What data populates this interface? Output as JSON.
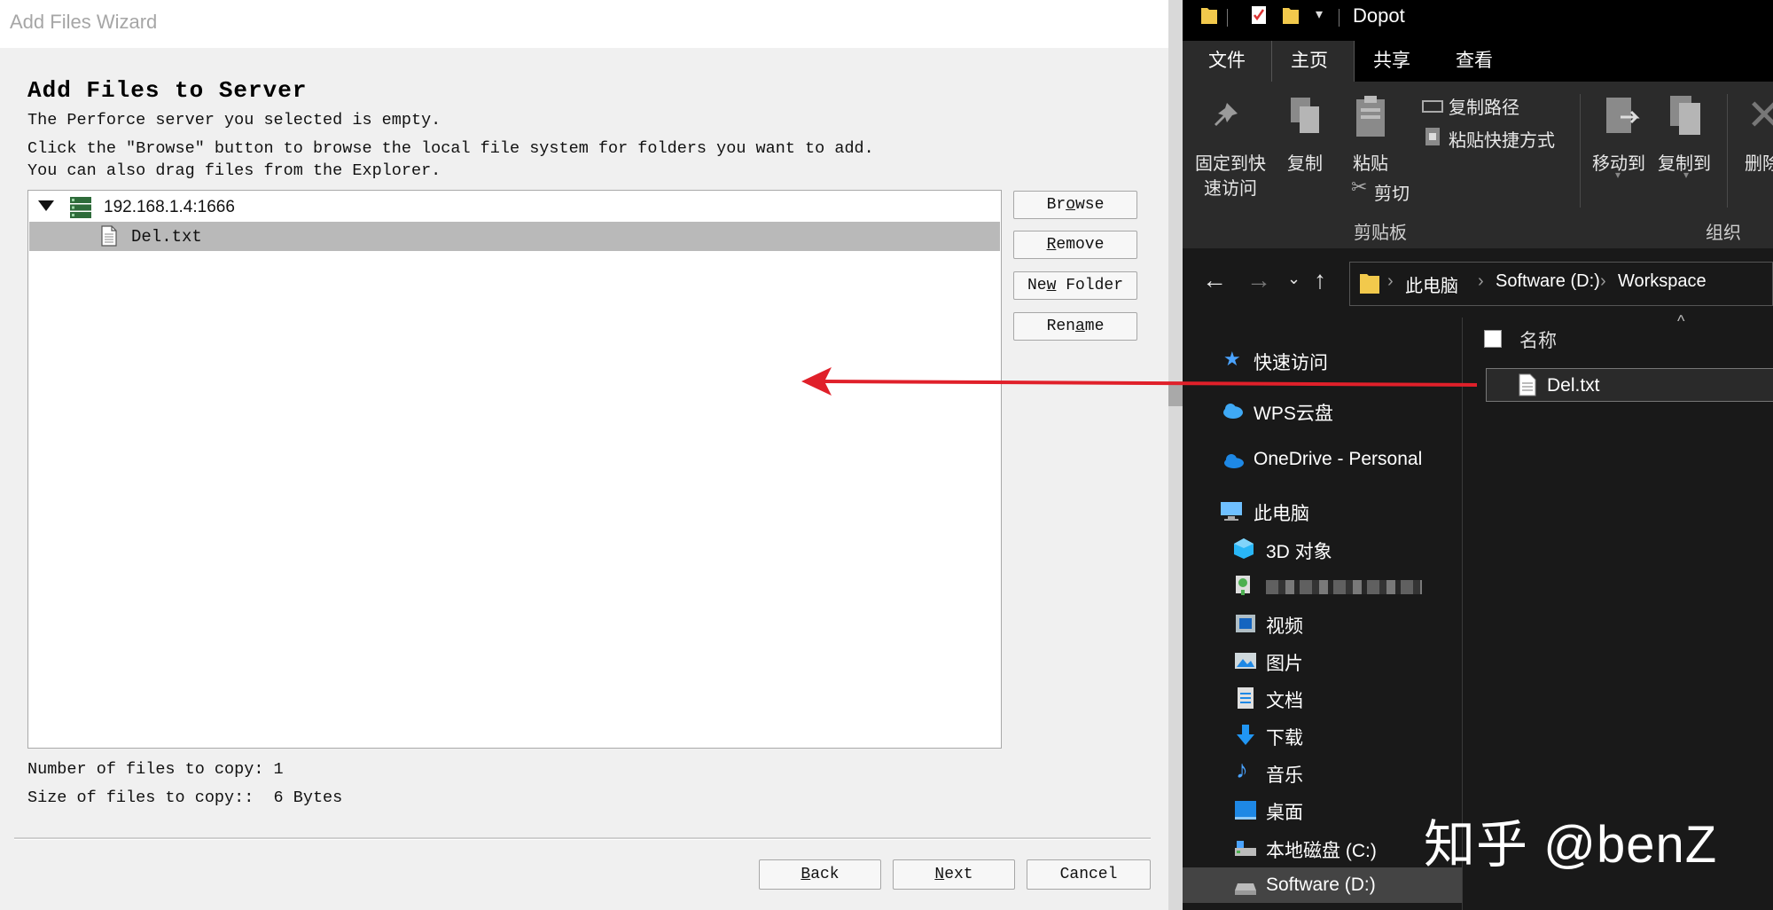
{
  "wizard": {
    "window_title": "Add Files Wizard",
    "heading": "Add Files to Server",
    "lines": [
      "The Perforce server you selected is empty.",
      "Click the \"Browse\" button to browse the local file system for folders you want to add.",
      "You can also drag files from the Explorer."
    ],
    "tree": {
      "server": "192.168.1.4:1666",
      "file": "Del.txt"
    },
    "side_buttons": [
      {
        "pre": "Br",
        "u": "o",
        "post": "wse"
      },
      {
        "pre": "",
        "u": "R",
        "post": "emove"
      },
      {
        "pre": "Ne",
        "u": "w",
        "post": " Folder"
      },
      {
        "pre": "Ren",
        "u": "a",
        "post": "me"
      }
    ],
    "stats": {
      "count_line": "Number of files to copy: 1",
      "size_line": "Size of files to copy::  6 Bytes"
    },
    "footer_buttons": [
      {
        "pre": "",
        "u": "B",
        "post": "ack"
      },
      {
        "pre": "",
        "u": "N",
        "post": "ext"
      },
      {
        "pre": "",
        "u": "",
        "post": "Cancel"
      }
    ]
  },
  "explorer": {
    "title": "Dopot",
    "tabs": [
      "文件",
      "主页",
      "共享",
      "查看"
    ],
    "ribbon": {
      "pin_label_1": "固定到快",
      "pin_label_2": "速访问",
      "copy_label": "复制",
      "paste_label": "粘贴",
      "copy_path_label": "复制路径",
      "paste_shortcut_label": "粘贴快捷方式",
      "cut_label": "剪切",
      "clipboard_group": "剪贴板",
      "move_to_label": "移动到",
      "copy_to_label": "复制到",
      "delete_label": "删除",
      "organize_group": "组织"
    },
    "breadcrumb": [
      "此电脑",
      "Software (D:)",
      "Workspace"
    ],
    "nav": {
      "quick_access": "快速访问",
      "wps": "WPS云盘",
      "onedrive": "OneDrive - Personal",
      "this_pc": "此电脑",
      "objects3d": "3D 对象",
      "videos": "视频",
      "pictures": "图片",
      "documents": "文档",
      "downloads": "下载",
      "music": "音乐",
      "desktop": "桌面",
      "local_disk": "本地磁盘 (C:)",
      "software_disk": "Software (D:)"
    },
    "column_name": "名称",
    "file_name": "Del.txt"
  },
  "watermark": "知乎 @benZ",
  "colors": {
    "arrow": "#e0202a",
    "selection": "#b9b9b9",
    "explorer_bg": "#191919"
  }
}
